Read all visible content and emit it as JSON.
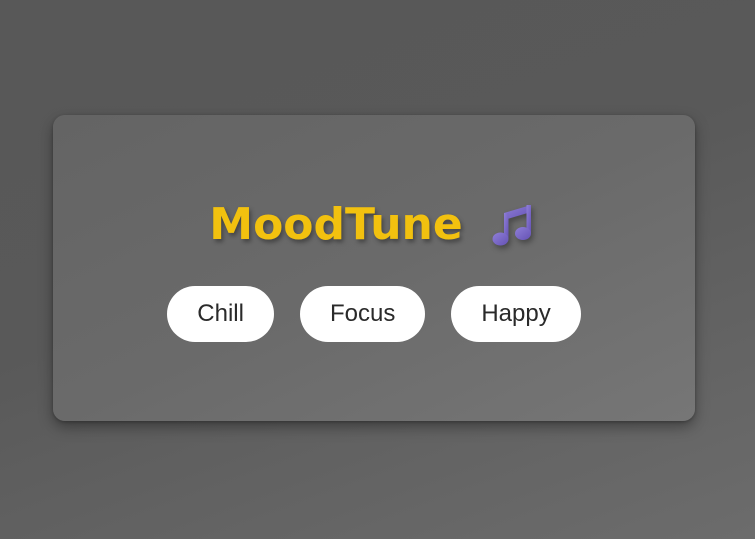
{
  "app": {
    "title": "MoodTune",
    "icon": "music-note-icon",
    "title_color": "#f2c10f",
    "icon_color": "#7a68c6"
  },
  "moods": [
    {
      "label": "Chill"
    },
    {
      "label": "Focus"
    },
    {
      "label": "Happy"
    }
  ]
}
